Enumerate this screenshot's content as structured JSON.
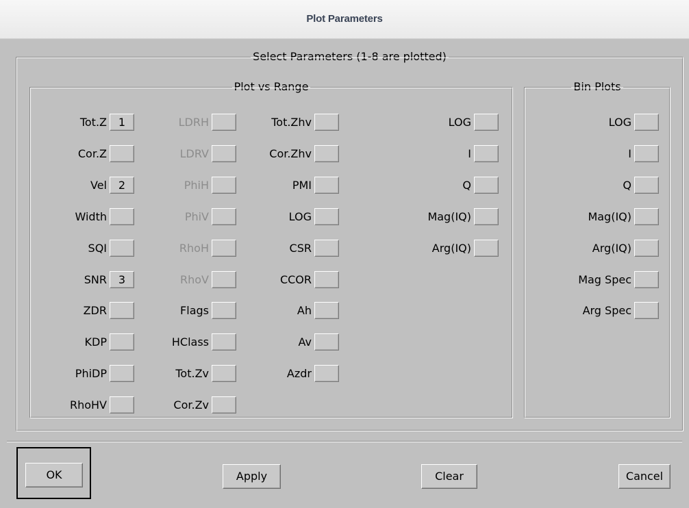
{
  "window": {
    "title": "Plot Parameters"
  },
  "select_group": {
    "label": "Select Parameters (1-8 are plotted)"
  },
  "range_group": {
    "label": "Plot vs Range",
    "col1": [
      {
        "label": "Tot.Z",
        "value": "1",
        "disabled": false
      },
      {
        "label": "Cor.Z",
        "value": "",
        "disabled": false
      },
      {
        "label": "Vel",
        "value": "2",
        "disabled": false
      },
      {
        "label": "Width",
        "value": "",
        "disabled": false
      },
      {
        "label": "SQI",
        "value": "",
        "disabled": false
      },
      {
        "label": "SNR",
        "value": "3",
        "disabled": false
      },
      {
        "label": "ZDR",
        "value": "",
        "disabled": false
      },
      {
        "label": "KDP",
        "value": "",
        "disabled": false
      },
      {
        "label": "PhiDP",
        "value": "",
        "disabled": false
      },
      {
        "label": "RhoHV",
        "value": "",
        "disabled": false
      }
    ],
    "col2": [
      {
        "label": "LDRH",
        "value": "",
        "disabled": true
      },
      {
        "label": "LDRV",
        "value": "",
        "disabled": true
      },
      {
        "label": "PhiH",
        "value": "",
        "disabled": true
      },
      {
        "label": "PhiV",
        "value": "",
        "disabled": true
      },
      {
        "label": "RhoH",
        "value": "",
        "disabled": true
      },
      {
        "label": "RhoV",
        "value": "",
        "disabled": true
      },
      {
        "label": "Flags",
        "value": "",
        "disabled": false
      },
      {
        "label": "HClass",
        "value": "",
        "disabled": false
      },
      {
        "label": "Tot.Zv",
        "value": "",
        "disabled": false
      },
      {
        "label": "Cor.Zv",
        "value": "",
        "disabled": false
      }
    ],
    "col3": [
      {
        "label": "Tot.Zhv",
        "value": "",
        "disabled": false
      },
      {
        "label": "Cor.Zhv",
        "value": "",
        "disabled": false
      },
      {
        "label": "PMI",
        "value": "",
        "disabled": false
      },
      {
        "label": "LOG",
        "value": "",
        "disabled": false
      },
      {
        "label": "CSR",
        "value": "",
        "disabled": false
      },
      {
        "label": "CCOR",
        "value": "",
        "disabled": false
      },
      {
        "label": "Ah",
        "value": "",
        "disabled": false
      },
      {
        "label": "Av",
        "value": "",
        "disabled": false
      },
      {
        "label": "Azdr",
        "value": "",
        "disabled": false
      }
    ],
    "col4": [
      {
        "label": "LOG",
        "value": "",
        "disabled": false
      },
      {
        "label": "I",
        "value": "",
        "disabled": false
      },
      {
        "label": "Q",
        "value": "",
        "disabled": false
      },
      {
        "label": "Mag(IQ)",
        "value": "",
        "disabled": false
      },
      {
        "label": "Arg(IQ)",
        "value": "",
        "disabled": false
      }
    ]
  },
  "bin_group": {
    "label": "Bin Plots",
    "items": [
      {
        "label": "LOG",
        "value": "",
        "disabled": false
      },
      {
        "label": "I",
        "value": "",
        "disabled": false
      },
      {
        "label": "Q",
        "value": "",
        "disabled": false
      },
      {
        "label": "Mag(IQ)",
        "value": "",
        "disabled": false
      },
      {
        "label": "Arg(IQ)",
        "value": "",
        "disabled": false
      },
      {
        "label": "Mag Spec",
        "value": "",
        "disabled": false
      },
      {
        "label": "Arg Spec",
        "value": "",
        "disabled": false
      }
    ]
  },
  "buttons": {
    "ok": "OK",
    "apply": "Apply",
    "clear": "Clear",
    "cancel": "Cancel"
  }
}
